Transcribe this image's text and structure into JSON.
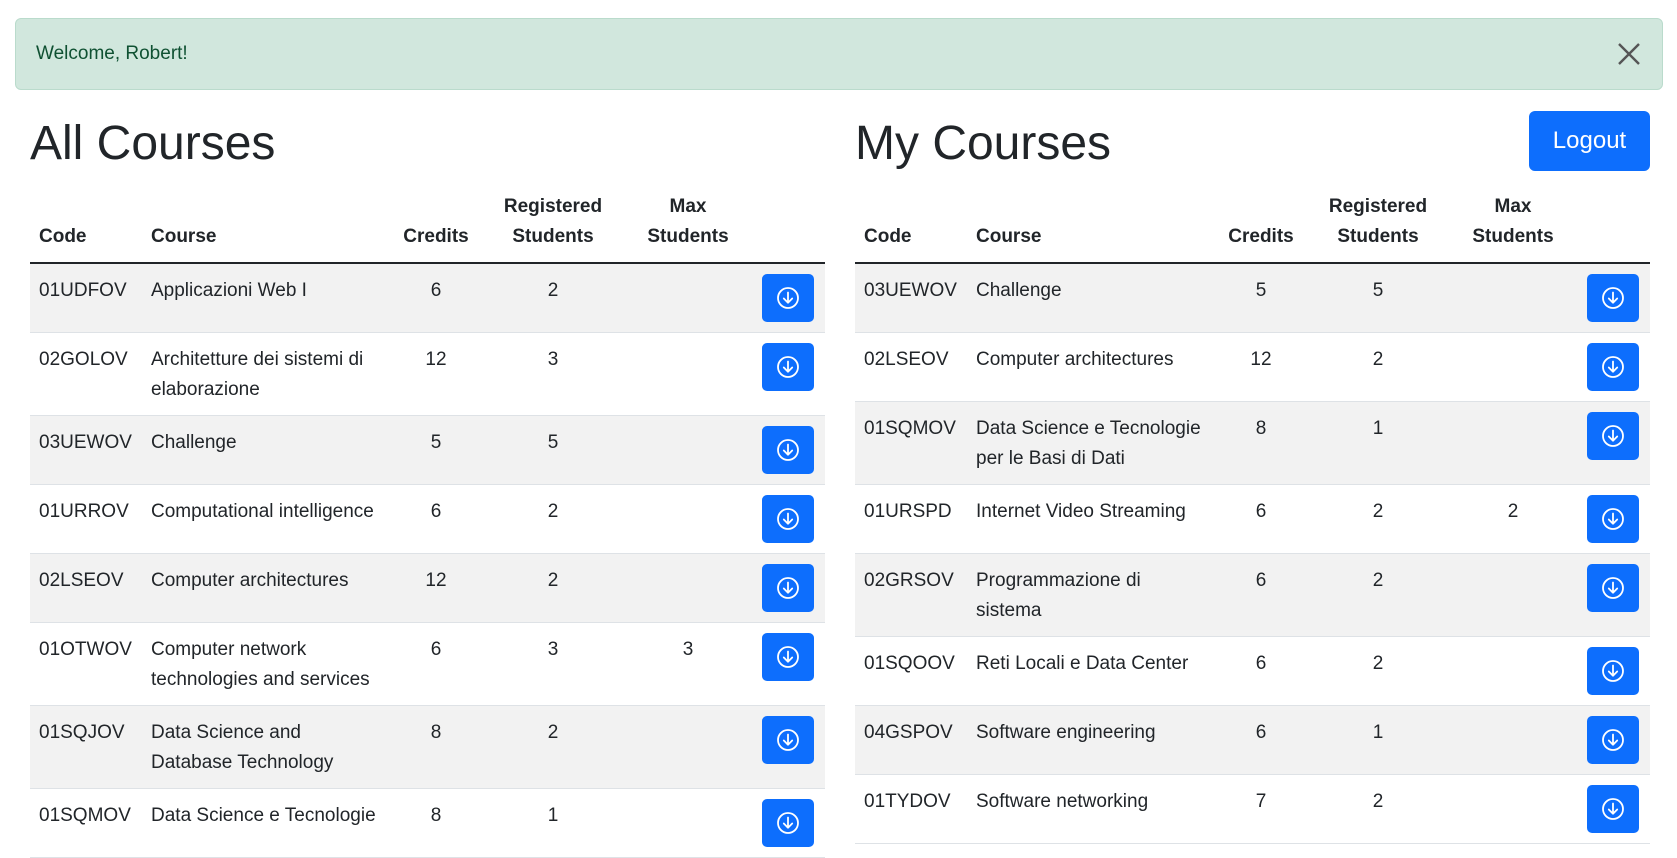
{
  "alert": {
    "message": "Welcome, Robert!"
  },
  "all_courses": {
    "title": "All Courses",
    "headers": [
      "Code",
      "Course",
      "Credits",
      "Registered Students",
      "Max Students"
    ],
    "rows": [
      {
        "code": "01UDFOV",
        "name": "Applicazioni Web I",
        "credits": "6",
        "registered": "2",
        "max": ""
      },
      {
        "code": "02GOLOV",
        "name": "Architetture dei sistemi di elaborazione",
        "credits": "12",
        "registered": "3",
        "max": ""
      },
      {
        "code": "03UEWOV",
        "name": "Challenge",
        "credits": "5",
        "registered": "5",
        "max": ""
      },
      {
        "code": "01URROV",
        "name": "Computational intelligence",
        "credits": "6",
        "registered": "2",
        "max": ""
      },
      {
        "code": "02LSEOV",
        "name": "Computer architectures",
        "credits": "12",
        "registered": "2",
        "max": ""
      },
      {
        "code": "01OTWOV",
        "name": "Computer network technologies and services",
        "credits": "6",
        "registered": "3",
        "max": "3"
      },
      {
        "code": "01SQJOV",
        "name": "Data Science and Database Technology",
        "credits": "8",
        "registered": "2",
        "max": ""
      },
      {
        "code": "01SQMOV",
        "name": "Data Science e Tecnologie",
        "credits": "8",
        "registered": "1",
        "max": ""
      }
    ]
  },
  "my_courses": {
    "title": "My Courses",
    "logout_label": "Logout",
    "headers": [
      "Code",
      "Course",
      "Credits",
      "Registered Students",
      "Max Students"
    ],
    "rows": [
      {
        "code": "03UEWOV",
        "name": "Challenge",
        "credits": "5",
        "registered": "5",
        "max": ""
      },
      {
        "code": "02LSEOV",
        "name": "Computer architectures",
        "credits": "12",
        "registered": "2",
        "max": ""
      },
      {
        "code": "01SQMOV",
        "name": "Data Science e Tecnologie per le Basi di Dati",
        "credits": "8",
        "registered": "1",
        "max": ""
      },
      {
        "code": "01URSPD",
        "name": "Internet Video Streaming",
        "credits": "6",
        "registered": "2",
        "max": "2"
      },
      {
        "code": "02GRSOV",
        "name": "Programmazione di sistema",
        "credits": "6",
        "registered": "2",
        "max": ""
      },
      {
        "code": "01SQOOV",
        "name": "Reti Locali e Data Center",
        "credits": "6",
        "registered": "2",
        "max": ""
      },
      {
        "code": "04GSPOV",
        "name": "Software engineering",
        "credits": "6",
        "registered": "1",
        "max": ""
      },
      {
        "code": "01TYDOV",
        "name": "Software networking",
        "credits": "7",
        "registered": "2",
        "max": ""
      }
    ]
  },
  "icons": {
    "close": "close-icon",
    "download": "arrow-down-circle-icon"
  },
  "colors": {
    "primary": "#0d6efd",
    "alert_bg": "#d1e7dd",
    "alert_text": "#0f5132",
    "stripe": "#f2f2f2"
  }
}
